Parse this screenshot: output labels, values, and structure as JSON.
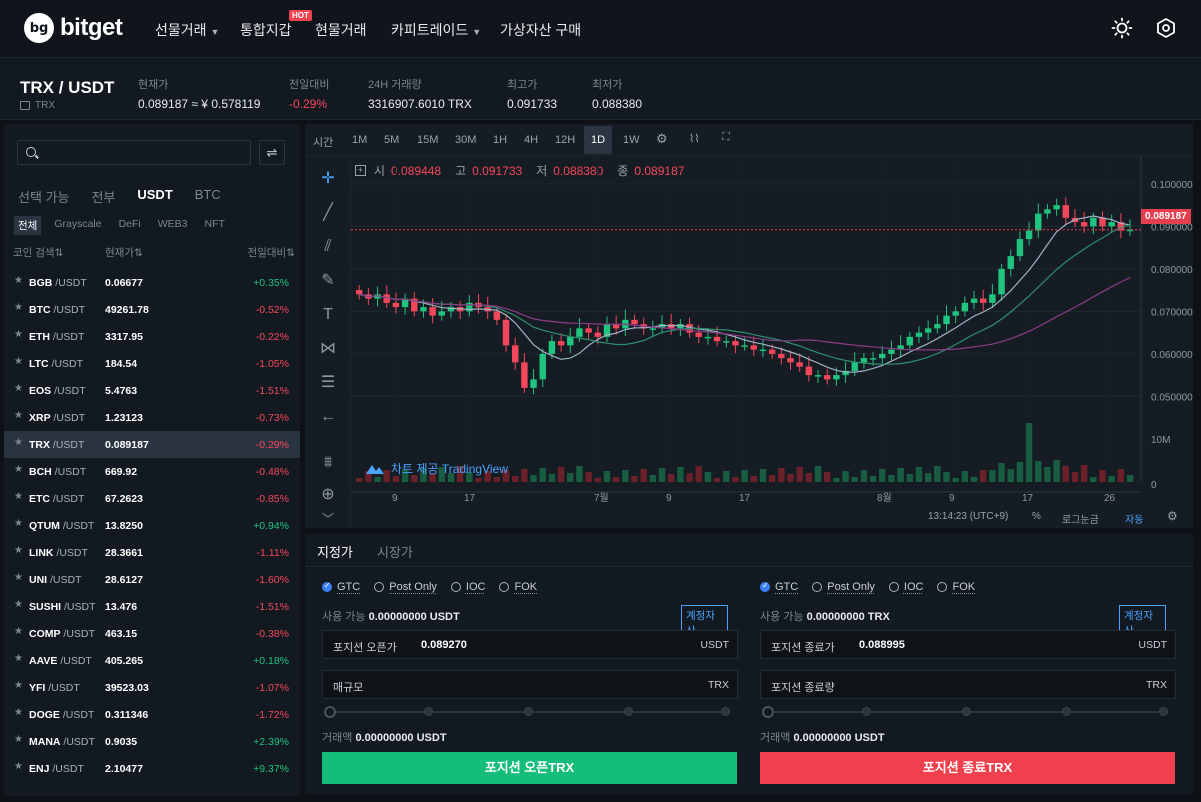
{
  "nav": {
    "logo_mark": "bg",
    "logo_text": "bitget",
    "items": [
      {
        "label": "선물거래",
        "caret": true
      },
      {
        "label": "통합지갑",
        "caret": false
      },
      {
        "label": "현물거래",
        "caret": false
      },
      {
        "label": "카피트레이드",
        "caret": true
      },
      {
        "label": "가상자산 구매",
        "caret": false
      }
    ],
    "hot_badge": "HOT"
  },
  "ticker": {
    "pair": "TRX / USDT",
    "pair_sub": "TRX",
    "stats": [
      {
        "label": "현재가",
        "value": "0.089187 ≈ ¥ 0.578119"
      },
      {
        "label": "전일대비",
        "value": "-0.29%"
      },
      {
        "label": "24H 거래량",
        "value": "3316907.6010 TRX"
      },
      {
        "label": "최고가",
        "value": "0.091733"
      },
      {
        "label": "최저가",
        "value": "0.088380"
      }
    ]
  },
  "market": {
    "tabs": [
      "선택 가능",
      "전부",
      "USDT",
      "BTC"
    ],
    "active_tab": "USDT",
    "filters": [
      "전체",
      "Grayscale",
      "DeFi",
      "WEB3",
      "NFT"
    ],
    "active_filter": "전체",
    "headers": {
      "coin": "코인 검색⇅",
      "price": "현재가⇅",
      "change": "전일대비⇅"
    },
    "rows": [
      {
        "coin": "BGB",
        "quote": " /USDT",
        "price": "0.06677",
        "change": "+0.35%",
        "up": true
      },
      {
        "coin": "BTC",
        "quote": " /USDT",
        "price": "49261.78",
        "change": "-0.52%",
        "up": false
      },
      {
        "coin": "ETH",
        "quote": " /USDT",
        "price": "3317.95",
        "change": "-0.22%",
        "up": false
      },
      {
        "coin": "LTC",
        "quote": " /USDT",
        "price": "184.54",
        "change": "-1.05%",
        "up": false
      },
      {
        "coin": "EOS",
        "quote": " /USDT",
        "price": "5.4763",
        "change": "-1.51%",
        "up": false
      },
      {
        "coin": "XRP",
        "quote": " /USDT",
        "price": "1.23123",
        "change": "-0.73%",
        "up": false
      },
      {
        "coin": "TRX",
        "quote": " /USDT",
        "price": "0.089187",
        "change": "-0.29%",
        "up": false,
        "selected": true
      },
      {
        "coin": "BCH",
        "quote": " /USDT",
        "price": "669.92",
        "change": "-0.48%",
        "up": false
      },
      {
        "coin": "ETC",
        "quote": " /USDT",
        "price": "67.2623",
        "change": "-0.85%",
        "up": false
      },
      {
        "coin": "QTUM",
        "quote": " /USDT",
        "price": "13.8250",
        "change": "+0.94%",
        "up": true
      },
      {
        "coin": "LINK",
        "quote": " /USDT",
        "price": "28.3661",
        "change": "-1.11%",
        "up": false
      },
      {
        "coin": "UNI",
        "quote": " /USDT",
        "price": "28.6127",
        "change": "-1.60%",
        "up": false
      },
      {
        "coin": "SUSHI",
        "quote": " /USDT",
        "price": "13.476",
        "change": "-1.51%",
        "up": false
      },
      {
        "coin": "COMP",
        "quote": " /USDT",
        "price": "463.15",
        "change": "-0.38%",
        "up": false
      },
      {
        "coin": "AAVE",
        "quote": " /USDT",
        "price": "405.265",
        "change": "+0.18%",
        "up": true
      },
      {
        "coin": "YFI",
        "quote": " /USDT",
        "price": "39523.03",
        "change": "-1.07%",
        "up": false
      },
      {
        "coin": "DOGE",
        "quote": " /USDT",
        "price": "0.311346",
        "change": "-1.72%",
        "up": false
      },
      {
        "coin": "MANA",
        "quote": " /USDT",
        "price": "0.9035",
        "change": "+2.39%",
        "up": true
      },
      {
        "coin": "ENJ",
        "quote": " /USDT",
        "price": "2.10477",
        "change": "+9.37%",
        "up": true
      }
    ]
  },
  "chart": {
    "toolbar": [
      "시간",
      "1M",
      "5M",
      "15M",
      "30M",
      "1H",
      "4H",
      "12H",
      "1D",
      "1W"
    ],
    "active_interval": "1D",
    "ohlc": {
      "open_label": "시",
      "open": "0.089448",
      "high_label": "고",
      "high": "0.091733",
      "low_label": "저",
      "low": "0.088380",
      "close_label": "종",
      "close": "0.089187"
    },
    "last_price_tag": "0.089187",
    "price_axis": [
      "0.100000",
      "0.090000",
      "0.080000",
      "0.070000",
      "0.060000",
      "0.050000"
    ],
    "volume_axis": [
      "10M",
      "0"
    ],
    "time_axis": [
      "9",
      "17",
      "7월",
      "9",
      "17",
      "8월",
      "9",
      "17",
      "26"
    ],
    "tradingview": "차트 제공 TradingView",
    "footer": {
      "time": "13:14:23 (UTC+9)",
      "pct": "%",
      "log": "로그눈금",
      "auto": "자동"
    }
  },
  "order": {
    "tabs": [
      "지정가",
      "시장가"
    ],
    "active_tab": "지정가",
    "tif": [
      "GTC",
      "Post Only",
      "IOC",
      "FOK"
    ],
    "left": {
      "available_label": "사용 가능",
      "available_value": "0.00000000 USDT",
      "account_btn": "계정자산",
      "price_label": "포지션 오픈가",
      "price_value": "0.089270",
      "price_unit": "USDT",
      "size_label": "매규모",
      "size_unit": "TRX",
      "volume_label": "거래액",
      "volume_value": "0.00000000 USDT",
      "submit": "포지션 오픈TRX"
    },
    "right": {
      "available_label": "사용 가능",
      "available_value": "0.00000000 TRX",
      "account_btn": "계정자산",
      "price_label": "포지션 종료가",
      "price_value": "0.088995",
      "price_unit": "USDT",
      "size_label": "포지션 종료량",
      "size_unit": "TRX",
      "volume_label": "거래액",
      "volume_value": "0.00000000 USDT",
      "submit": "포지션 종료TRX"
    }
  },
  "colors": {
    "up": "#1fc47f",
    "down": "#f5475b",
    "buy": "#14bd7a",
    "sell": "#f0404d",
    "accent": "#4aa3ff"
  }
}
